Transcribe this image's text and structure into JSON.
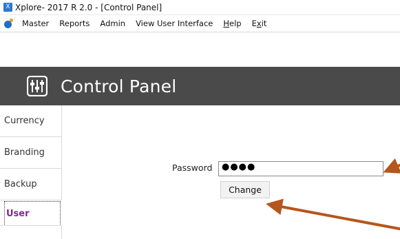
{
  "window": {
    "title": "Xplore- 2017 R 2.0  - [Control Panel]",
    "app_icon_glyph": "X"
  },
  "menu": {
    "items": [
      "Master",
      "Reports",
      "Admin",
      "View User Interface",
      "Help",
      "Exit"
    ]
  },
  "banner": {
    "title": "Control Panel",
    "icon": "sliders-icon"
  },
  "sidebar": {
    "tabs": [
      "Currency",
      "Branding",
      "Backup",
      "User"
    ],
    "active_tab": "User"
  },
  "form": {
    "password_label": "Password",
    "password_value": "●●●●",
    "change_button": "Change"
  },
  "colors": {
    "banner_bg": "#4a4a4a",
    "active_tab_text": "#7a2b8c",
    "annotation_arrow": "#b5561c"
  }
}
